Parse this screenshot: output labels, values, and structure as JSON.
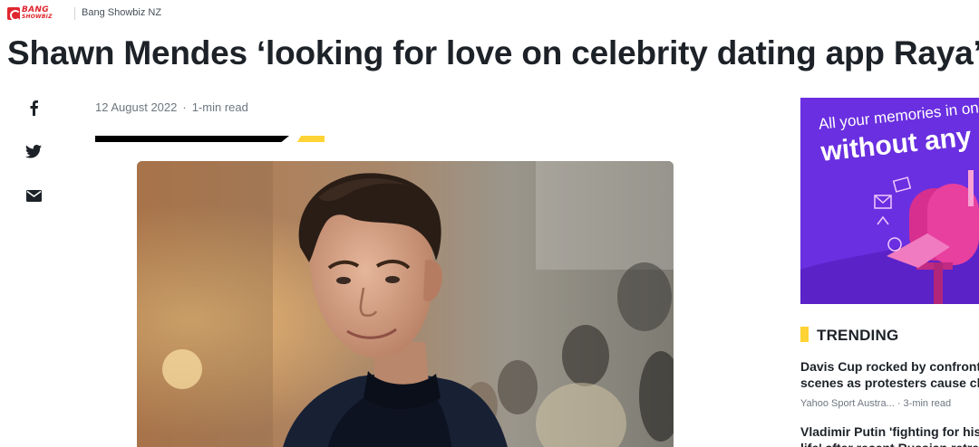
{
  "header": {
    "logo_text_top": "BANG",
    "logo_text_bottom": "SHOWBIZ",
    "publisher": "Bang Showbiz NZ"
  },
  "article": {
    "headline": "Shawn Mendes ‘looking for love on celebrity dating app Raya’",
    "date": "12 August 2022",
    "separator": "·",
    "read_time": "1-min read",
    "hero_image": "shawn-mendes-photo"
  },
  "share": {
    "icons": [
      "facebook-icon",
      "twitter-icon",
      "mail-icon"
    ]
  },
  "ad": {
    "line1": "All your memories in on",
    "line2": "without any l"
  },
  "trending": {
    "title": "TRENDING",
    "stories": [
      {
        "title_line1": "Davis Cup rocked by confronting",
        "title_line2": "scenes as protesters cause chaos",
        "source": "Yahoo Sport Austra...",
        "read_time": "3-min read"
      },
      {
        "title_line1": "Vladimir Putin 'fighting for his",
        "title_line2": "life' after recent Russian retreat"
      }
    ]
  },
  "colors": {
    "accent_yellow": "#ffd333",
    "brand_red": "#e0262f",
    "ad_purple": "#6a2fe0"
  }
}
